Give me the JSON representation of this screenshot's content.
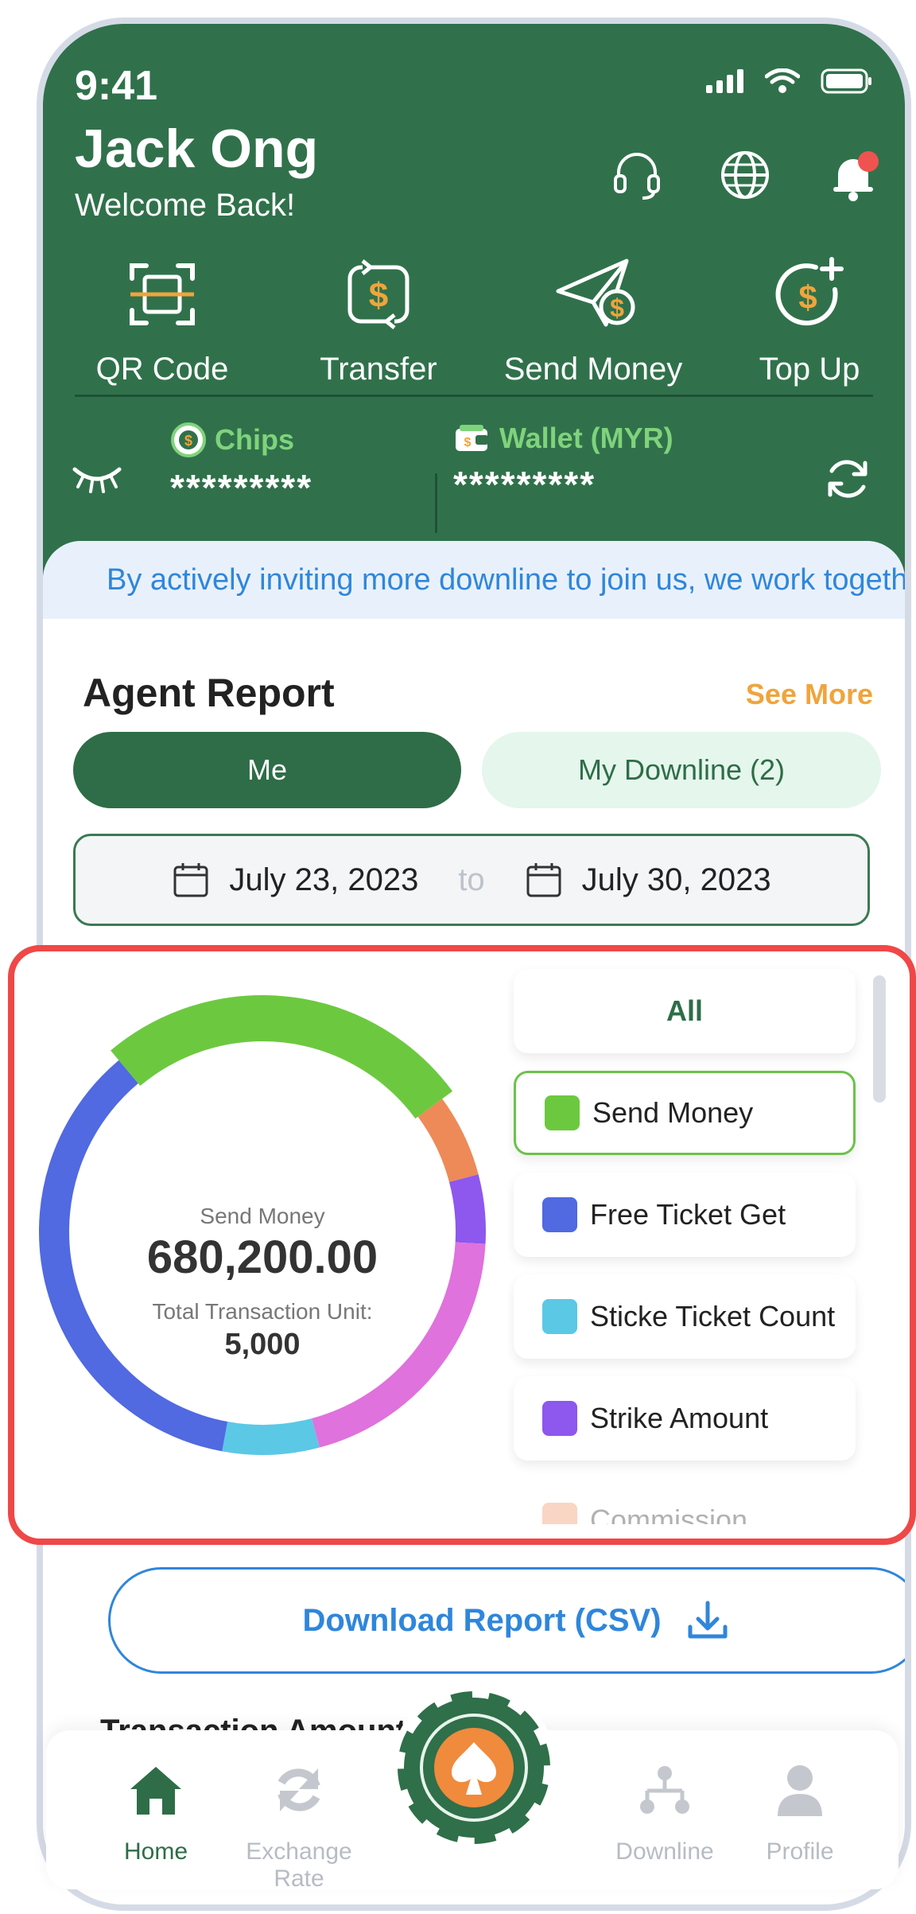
{
  "status": {
    "time": "9:41"
  },
  "user": {
    "name": "Jack Ong",
    "greeting": "Welcome Back!"
  },
  "header_icons": [
    "headset-icon",
    "globe-icon",
    "bell-icon"
  ],
  "quick_actions": [
    {
      "label": "QR Code",
      "icon": "qr-code-icon"
    },
    {
      "label": "Transfer",
      "icon": "transfer-icon"
    },
    {
      "label": "Send Money",
      "icon": "send-money-icon"
    },
    {
      "label": "Top Up",
      "icon": "top-up-icon"
    }
  ],
  "balances": {
    "chips": {
      "label": "Chips",
      "value": "*********"
    },
    "wallet": {
      "label": "Wallet (MYR)",
      "value": "*********"
    }
  },
  "announcement": "By actively inviting more downline to join us, we work together",
  "report": {
    "title": "Agent Report",
    "see_more": "See More",
    "segments": {
      "me": "Me",
      "downline": "My Downline (2)"
    },
    "date_from": "July 23, 2023",
    "date_sep": "to",
    "date_to": "July 30, 2023"
  },
  "donut": {
    "caption": "Send Money",
    "amount": "680,200.00",
    "unit_label": "Total Transaction Unit:",
    "unit_value": "5,000"
  },
  "chart_data": {
    "type": "pie",
    "title": "",
    "donut": true,
    "series": [
      {
        "name": "Send Money",
        "value": 26,
        "color": "#6cc93f"
      },
      {
        "name": "Commission",
        "value": 6,
        "color": "#ee8a58"
      },
      {
        "name": "Strike Amount",
        "value": 5,
        "color": "#8e57ee"
      },
      {
        "name": "",
        "value": 20,
        "color": "#df72dc"
      },
      {
        "name": "Sticke Ticket Count",
        "value": 7,
        "color": "#5bc8e6"
      },
      {
        "name": "Free Ticket Get",
        "value": 36,
        "color": "#5169e1"
      }
    ],
    "highlighted": "Send Money"
  },
  "legend": {
    "all": "All",
    "items": [
      {
        "label": "Send Money",
        "color": "#6cc93f"
      },
      {
        "label": "Free Ticket Get",
        "color": "#5169e1"
      },
      {
        "label": "Sticke Ticket Count",
        "color": "#5bc8e6"
      },
      {
        "label": "Strike Amount",
        "color": "#8e57ee"
      },
      {
        "label": "Commission",
        "color": "#ee8a58"
      }
    ]
  },
  "download": {
    "label": "Download Report (CSV)"
  },
  "transactions": {
    "title": "Transaction Amount"
  },
  "tabs": [
    {
      "label": "Home",
      "icon": "home-icon",
      "active": true
    },
    {
      "label": "Exchange Rate",
      "icon": "exchange-icon",
      "active": false
    },
    {
      "label": "Downline",
      "icon": "downline-icon",
      "active": false
    },
    {
      "label": "Profile",
      "icon": "profile-icon",
      "active": false
    }
  ],
  "colors": {
    "brand_green": "#30714b",
    "accent_orange": "#f0a43c",
    "link_blue": "#2f86db",
    "highlight_red": "#f04747"
  }
}
